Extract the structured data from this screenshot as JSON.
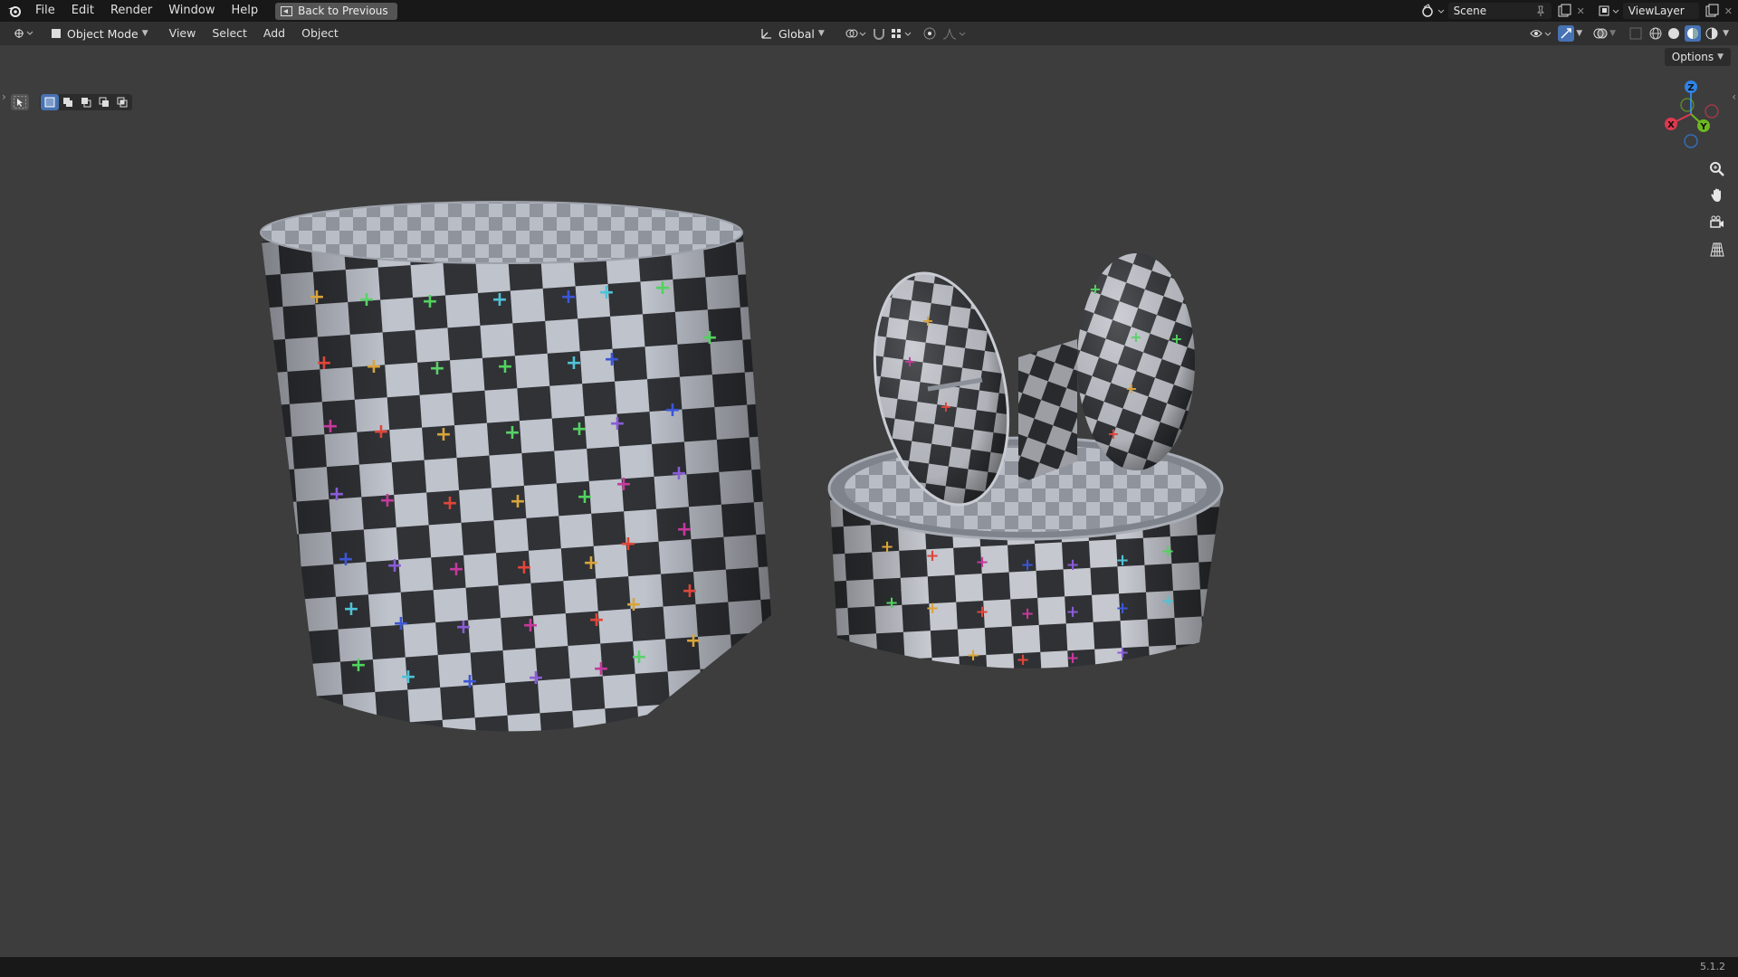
{
  "topbar": {
    "logo_icon": "blender-logo-icon",
    "menu": [
      "File",
      "Edit",
      "Render",
      "Window",
      "Help"
    ],
    "back_button": "Back to Previous",
    "scene": "Scene",
    "view_layer": "ViewLayer"
  },
  "header": {
    "mode": "Object Mode",
    "menus": [
      "View",
      "Select",
      "Add",
      "Object"
    ],
    "transform_orientation": "Global"
  },
  "toolbar": {
    "options_label": "Options"
  },
  "gizmo": {
    "z": "Z",
    "x": "X",
    "y": "Y"
  },
  "status": {
    "version": "5.1.2"
  },
  "colors": {
    "topbar_bg": "#181818",
    "header_bg": "#303030",
    "viewport_bg": "#3d3d3d",
    "accent": "#4772b3",
    "axis_x": "#e0384f",
    "axis_y": "#6eb820",
    "axis_z": "#2f83e6"
  }
}
